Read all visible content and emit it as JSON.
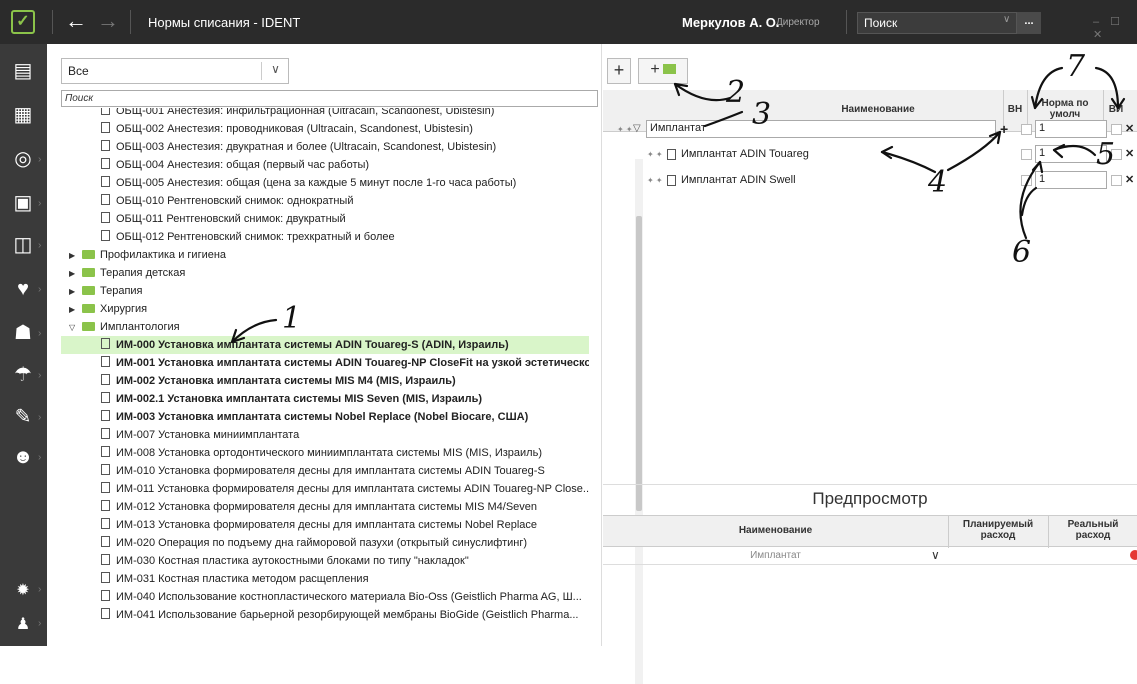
{
  "titlebar": {
    "window_title": "Нормы списания - IDENT",
    "user_name": "Меркулов А. О.",
    "user_role": "Директор",
    "search_value": "Поиск",
    "search_button": "...",
    "window_controls": "– ☐ ✕"
  },
  "rail": {
    "icons": [
      "profile-card-icon",
      "calendar-icon",
      "dental-chart-icon",
      "calculator-icon",
      "reports-icon",
      "tooth-icon",
      "users-icon",
      "umbrella-icon",
      "syringe-icon",
      "search-person-icon"
    ],
    "bottom_icons": [
      "gear-icon",
      "user-icon"
    ]
  },
  "left": {
    "filter_value": "Все",
    "search_placeholder": "Поиск",
    "rows": [
      {
        "indent": 3,
        "kind": "doc",
        "text": "ОБЩ-001 Анестезия: инфильтрационная (Ultracain, Scandonest, Ubistesin)",
        "bold": false
      },
      {
        "indent": 3,
        "kind": "doc",
        "text": "ОБЩ-002 Анестезия: проводниковая (Ultracain, Scandonest, Ubistesin)",
        "bold": false
      },
      {
        "indent": 3,
        "kind": "doc",
        "text": "ОБЩ-003 Анестезия: двукратная и более (Ultracain, Scandonest, Ubistesin)",
        "bold": false
      },
      {
        "indent": 3,
        "kind": "doc",
        "text": "ОБЩ-004 Анестезия: общая (первый час работы)",
        "bold": false
      },
      {
        "indent": 3,
        "kind": "doc",
        "text": "ОБЩ-005 Анестезия: общая (цена за каждые 5 минут после 1-го часа работы)",
        "bold": false
      },
      {
        "indent": 3,
        "kind": "doc",
        "text": "ОБЩ-010 Рентгеновский снимок: однократный",
        "bold": false
      },
      {
        "indent": 3,
        "kind": "doc",
        "text": "ОБЩ-011 Рентгеновский снимок: двукратный",
        "bold": false
      },
      {
        "indent": 3,
        "kind": "doc",
        "text": "ОБЩ-012 Рентгеновский снимок: трехкратный и более",
        "bold": false
      },
      {
        "indent": 1,
        "kind": "folder",
        "caret": "▶",
        "text": "Профилактика и гигиена",
        "bold": false
      },
      {
        "indent": 1,
        "kind": "folder",
        "caret": "▶",
        "text": "Терапия детская",
        "bold": false
      },
      {
        "indent": 1,
        "kind": "folder",
        "caret": "▶",
        "text": "Терапия",
        "bold": false
      },
      {
        "indent": 1,
        "kind": "folder",
        "caret": "▶",
        "text": "Хирургия",
        "bold": false
      },
      {
        "indent": 1,
        "kind": "folder",
        "caret": "▽",
        "text": "Имплантология",
        "bold": false
      },
      {
        "indent": 3,
        "kind": "doc",
        "text": "ИМ-000 Установка имплантата системы ADIN Touareg-S (ADIN, Израиль)",
        "bold": true,
        "selected": true
      },
      {
        "indent": 3,
        "kind": "doc",
        "text": "ИМ-001 Установка имплантата системы ADIN Touareg-NP CloseFit на узкой эстетической...",
        "bold": true
      },
      {
        "indent": 3,
        "kind": "doc",
        "text": "ИМ-002 Установка имплантата системы MIS M4 (MIS, Израиль)",
        "bold": true
      },
      {
        "indent": 3,
        "kind": "doc",
        "text": "ИМ-002.1 Установка имплантата системы MIS Seven (MIS, Израиль)",
        "bold": true
      },
      {
        "indent": 3,
        "kind": "doc",
        "text": "ИМ-003 Установка имплантата системы Nobel Replace (Nobel Biocare, США)",
        "bold": true
      },
      {
        "indent": 3,
        "kind": "doc",
        "text": "ИМ-007 Установка миниимплантата",
        "bold": false
      },
      {
        "indent": 3,
        "kind": "doc",
        "text": "ИМ-008 Установка ортодонтического миниимплантата системы MIS (MIS, Израиль)",
        "bold": false
      },
      {
        "indent": 3,
        "kind": "doc",
        "text": "ИМ-010 Установка формирователя десны для имплантата системы ADIN Touareg-S",
        "bold": false
      },
      {
        "indent": 3,
        "kind": "doc",
        "text": "ИМ-011 Установка формирователя десны для имплантата системы ADIN Touareg-NP Close...",
        "bold": false
      },
      {
        "indent": 3,
        "kind": "doc",
        "text": "ИМ-012 Установка формирователя десны для имплантата системы MIS M4/Seven",
        "bold": false
      },
      {
        "indent": 3,
        "kind": "doc",
        "text": "ИМ-013 Установка формирователя десны для имплантата системы Nobel Replace",
        "bold": false
      },
      {
        "indent": 3,
        "kind": "doc",
        "text": "ИМ-020 Операция по подъему дна гайморовой пазухи (открытый синуслифтинг)",
        "bold": false
      },
      {
        "indent": 3,
        "kind": "doc",
        "text": "ИМ-030 Костная пластика аутокостными блоками по типу \"накладок\"",
        "bold": false
      },
      {
        "indent": 3,
        "kind": "doc",
        "text": "ИМ-031 Костная пластика методом расщепления",
        "bold": false
      },
      {
        "indent": 3,
        "kind": "doc",
        "text": "ИМ-040 Использование костнопластического материала Bio-Oss (Geistlich Pharma AG, Ш...",
        "bold": false
      },
      {
        "indent": 3,
        "kind": "doc",
        "text": "ИМ-041 Использование барьерной резорбирующей мембраны BioGide (Geistlich Pharma...",
        "bold": false
      }
    ]
  },
  "right": {
    "add_button": "+",
    "add_group_button": "+",
    "headers": {
      "name": "Наименование",
      "vn": "ВН",
      "norm": "Норма по умолч",
      "vi": "ВИ"
    },
    "rows": [
      {
        "name": "Имплантат",
        "norm": "1",
        "kind": "group"
      },
      {
        "name": "Имплантат ADIN Touareg",
        "norm": "1",
        "kind": "item"
      },
      {
        "name": "Имплантат ADIN Swell",
        "norm": "1",
        "kind": "item"
      }
    ],
    "preview": {
      "title": "Предпросмотр",
      "col_name": "Наименование",
      "col_planned": "Планируемый расход",
      "col_real": "Реальный расход",
      "row_name": "Имплантат"
    }
  },
  "annotations": [
    "1",
    "2",
    "3",
    "4",
    "5",
    "6",
    "7"
  ]
}
